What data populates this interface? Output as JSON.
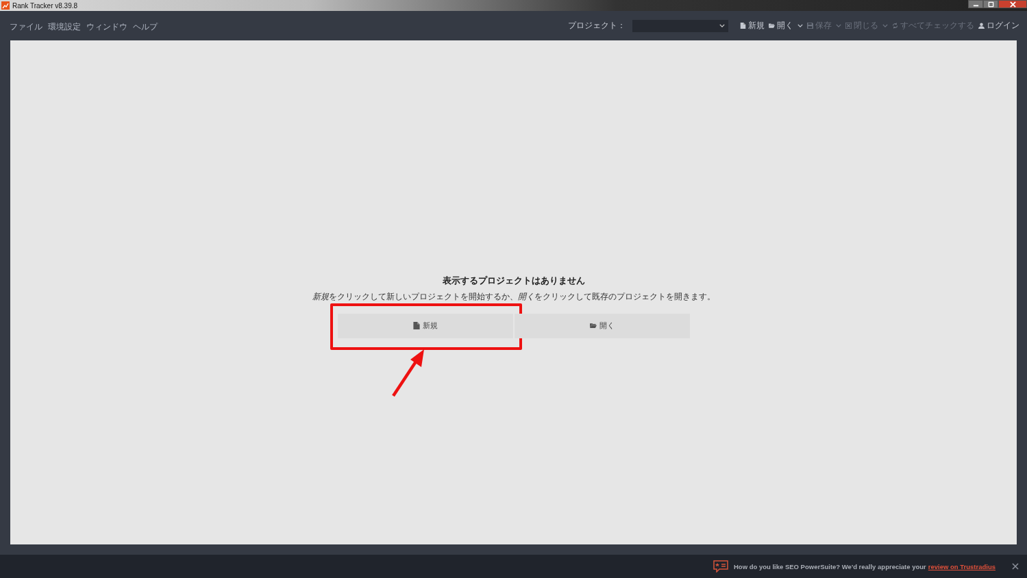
{
  "window": {
    "title": "Rank Tracker v8.39.8"
  },
  "menu": [
    "ファイル",
    "環境設定",
    "ウィンドウ",
    "ヘルプ"
  ],
  "project_selector": {
    "label": "プロジェクト："
  },
  "toolbar": [
    {
      "kind": "new",
      "label": "新規",
      "disabled": false,
      "dropdown": false
    },
    {
      "kind": "open",
      "label": "開く",
      "disabled": false,
      "dropdown": true
    },
    {
      "kind": "save",
      "label": "保存",
      "disabled": true,
      "dropdown": true
    },
    {
      "kind": "close",
      "label": "閉じる",
      "disabled": true,
      "dropdown": true
    },
    {
      "kind": "check",
      "label": "すべてチェックする",
      "disabled": true,
      "dropdown": false
    },
    {
      "kind": "login",
      "label": "ログイン",
      "disabled": false,
      "dropdown": false
    }
  ],
  "empty_state": {
    "heading": "表示するプロジェクトはありません",
    "message": [
      {
        "text": "新規",
        "italic": true
      },
      {
        "text": "をクリックして新しいプロジェクトを開始するか、",
        "italic": false
      },
      {
        "text": "開く",
        "italic": true
      },
      {
        "text": "をクリックして既存のプロジェクトを開きます。",
        "italic": false
      }
    ],
    "buttons": [
      {
        "kind": "new",
        "label": "新規",
        "highlighted": true
      },
      {
        "kind": "open",
        "label": "開く",
        "highlighted": false
      }
    ]
  },
  "notification": {
    "text": "How do you like SEO PowerSuite? We'd really appreciate your",
    "link": "review on Trustradius"
  }
}
